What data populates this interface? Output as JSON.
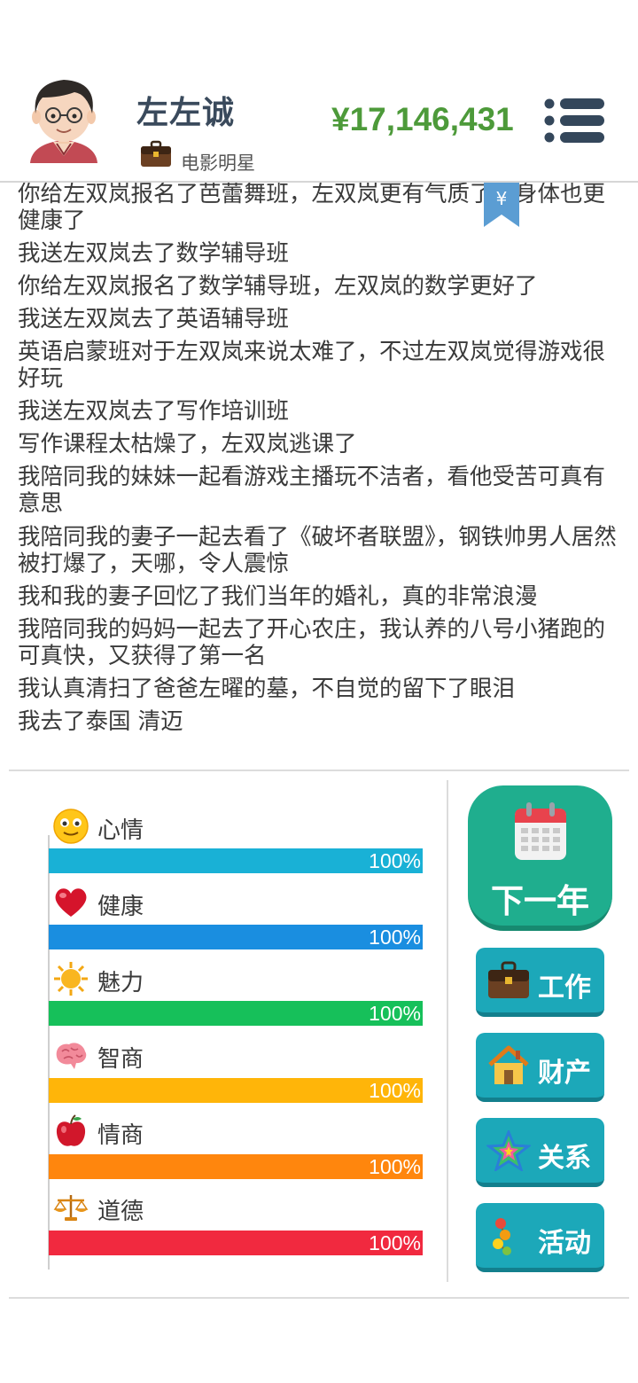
{
  "header": {
    "name": "左左诚",
    "job": "电影明星",
    "money": "¥17,146,431"
  },
  "bookmark": {
    "symbol": "¥"
  },
  "log": [
    "你给左双岚报名了芭蕾舞班，左双岚更有气质了，身体也更健康了",
    "我送左双岚去了数学辅导班",
    "你给左双岚报名了数学辅导班，左双岚的数学更好了",
    "我送左双岚去了英语辅导班",
    "英语启蒙班对于左双岚来说太难了，不过左双岚觉得游戏很好玩",
    "我送左双岚去了写作培训班",
    "写作课程太枯燥了，左双岚逃课了",
    "我陪同我的妹妹一起看游戏主播玩不洁者，看他受苦可真有意思",
    "我陪同我的妻子一起去看了《破坏者联盟》，钢铁帅男人居然被打爆了，天哪，令人震惊",
    "我和我的妻子回忆了我们当年的婚礼，真的非常浪漫",
    "我陪同我的妈妈一起去了开心农庄，我认养的八号小猪跑的可真快，又获得了第一名",
    "我认真清扫了爸爸左曜的墓，不自觉的留下了眼泪",
    "我去了泰国 清迈"
  ],
  "stats": [
    {
      "label": "心情",
      "percent": 100,
      "percent_text": "100%",
      "color": "#19b1d6",
      "icon": "smiley-icon"
    },
    {
      "label": "健康",
      "percent": 100,
      "percent_text": "100%",
      "color": "#1a8ee0",
      "icon": "heart-icon"
    },
    {
      "label": "魅力",
      "percent": 100,
      "percent_text": "100%",
      "color": "#16c05a",
      "icon": "sun-icon"
    },
    {
      "label": "智商",
      "percent": 100,
      "percent_text": "100%",
      "color": "#ffb509",
      "icon": "brain-icon"
    },
    {
      "label": "情商",
      "percent": 100,
      "percent_text": "100%",
      "color": "#ff860d",
      "icon": "apple-icon"
    },
    {
      "label": "道德",
      "percent": 100,
      "percent_text": "100%",
      "color": "#f1293f",
      "icon": "scales-icon"
    }
  ],
  "buttons": {
    "next_year": "下一年",
    "work": "工作",
    "assets": "财产",
    "relations": "关系",
    "activity": "活动"
  },
  "colors": {
    "money": "#4d9a3a",
    "next_year": "#1fae8e",
    "action": "#1ca8b9",
    "name": "#3a4a5c"
  }
}
